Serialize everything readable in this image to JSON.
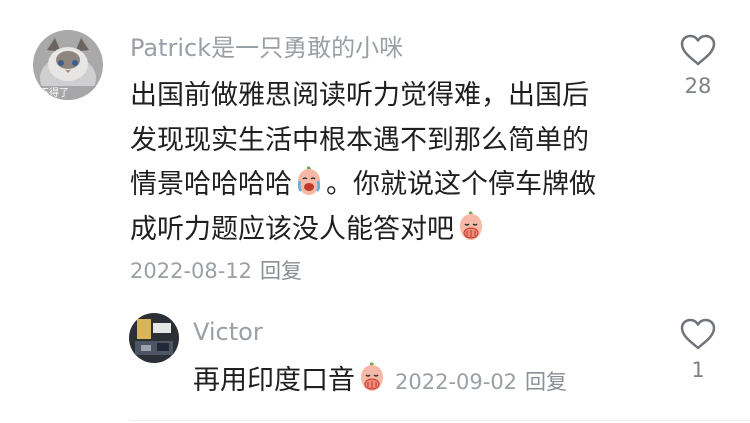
{
  "comment": {
    "username": "Patrick是一只勇敢的小咪",
    "avatar_icon": "cat-photo-avatar",
    "text_lines": [
      "出国前做雅思阅读听力觉得难，出国后",
      "发现现实生活中根本遇不到那么简单的",
      "情景哈哈哈哈",
      "。你就说这个停车牌做",
      "成听力题应该没人能答对吧"
    ],
    "emoji_laugh_cry": "laugh-cry-emoji-icon",
    "emoji_cover_mouth": "cover-mouth-emoji-icon",
    "date": "2022-08-12",
    "reply_label": "回复",
    "like_count": "28"
  },
  "reply": {
    "username": "Victor",
    "avatar_icon": "photo-avatar",
    "text": "再用印度口音",
    "emoji_cover_mouth": "cover-mouth-emoji-icon",
    "date": "2022-09-02",
    "reply_label": "回复",
    "like_count": "1"
  },
  "colors": {
    "secondary_text": "#9aa0a6",
    "primary_text": "#1f1f1f",
    "icon_stroke": "#6f747a"
  }
}
